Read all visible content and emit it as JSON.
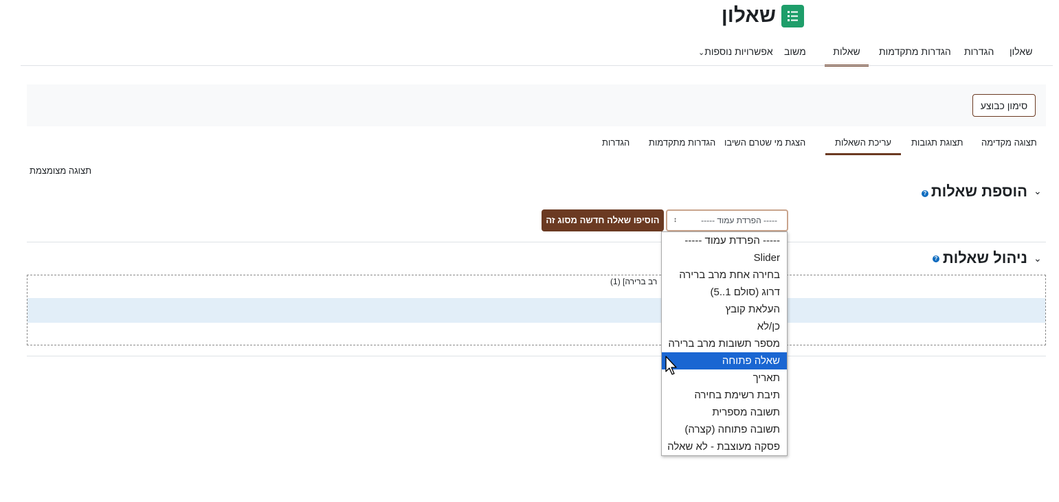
{
  "page": {
    "title": "שאלון",
    "icon": "survey-list-icon"
  },
  "primary_nav": [
    {
      "label": "שאלון",
      "active": false
    },
    {
      "label": "הגדרות",
      "active": false
    },
    {
      "label": "הגדרות מתקדמות",
      "active": false
    },
    {
      "label": "שאלות",
      "active": true
    },
    {
      "label": "משוב",
      "active": false
    },
    {
      "label": "אפשרויות נוספות",
      "active": false,
      "has_chevron": true
    }
  ],
  "mark_done_button": "סימון כבוצע",
  "secondary_nav": [
    {
      "label": "תצוגה מקדימה",
      "active": false
    },
    {
      "label": "תצוגת תגובות",
      "active": false
    },
    {
      "label": "עריכת השאלות",
      "active": true
    },
    {
      "label": "הצגת מי שטרם השיבו",
      "active": false
    },
    {
      "label": "הגדרות מתקדמות",
      "active": false
    },
    {
      "label": "הגדרות",
      "active": false
    }
  ],
  "compact_view_link": "תצוגה מצומצמת",
  "add_section": {
    "heading": "הוספת שאלות",
    "select_value": "----- הפרדת עמוד -----",
    "add_button": "הוסיפו שאלה חדשה מסוג זה"
  },
  "manage_section": {
    "heading": "ניהול שאלות",
    "question_snippet": "רב ברירה] (1)"
  },
  "dropdown_options": [
    "----- הפרדת עמוד -----",
    "Slider",
    "בחירה אחת מרב ברירה",
    "דרוג (סולם 1..5)",
    "העלאת קובץ",
    "כן/לא",
    "מספר תשובות מרב ברירה",
    "שאלה פתוחה",
    "תאריך",
    "תיבת רשימת בחירה",
    "תשובה מספרית",
    "תשובה פתוחה (קצרה)",
    "פסקה מעוצבת - לא שאלה"
  ],
  "dropdown_selected_index": 7,
  "colors": {
    "brand": "#6b3a22",
    "icon_bg": "#1e9e6a",
    "selected_option": "#1a66d2",
    "row_highlight": "#e2eef8"
  }
}
